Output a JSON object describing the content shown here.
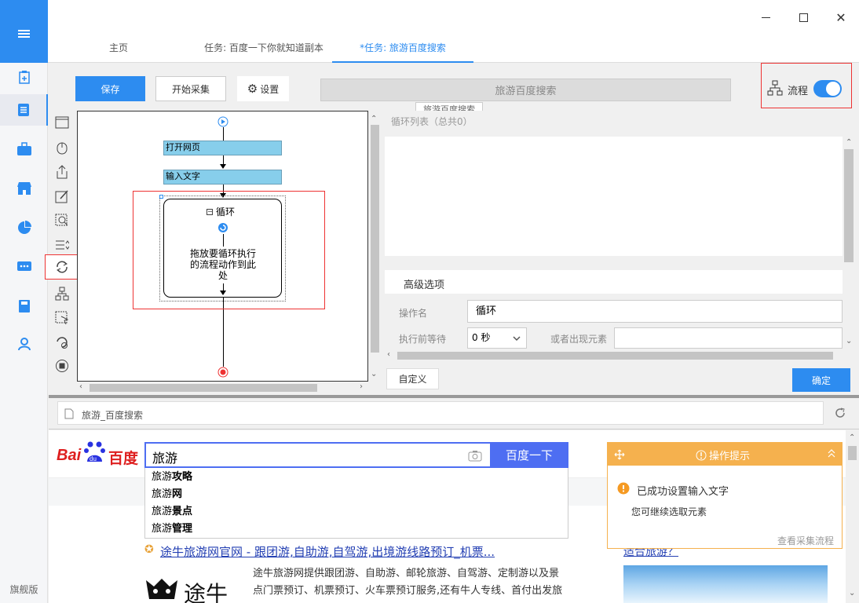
{
  "sidebar": {
    "edition": "旗舰版"
  },
  "tabs": [
    {
      "label": "主页"
    },
    {
      "label": "任务: 百度一下你就知道副本"
    },
    {
      "label": "*任务: 旅游百度搜索"
    }
  ],
  "toolbar": {
    "save": "保存",
    "start": "开始采集",
    "settings": "设置",
    "task_name": "旅游百度搜索",
    "tooltip": "旅游百度搜索",
    "flow_label": "流程"
  },
  "flow": {
    "node1": "打开网页",
    "node2": "输入文字",
    "loop_title": "循环",
    "drop_hint": "拖放要循环执行的流程动作到此处"
  },
  "panel": {
    "loop_list": "循环列表（总共0）",
    "advanced": "高级选项",
    "op_name_label": "操作名",
    "op_name_value": "循环",
    "wait_label": "执行前等待",
    "wait_value": "0 秒",
    "or_appear_label": "或者出现元素",
    "custom": "自定义",
    "confirm": "确定"
  },
  "browser": {
    "address": "旅游_百度搜索"
  },
  "baidu": {
    "query": "旅游",
    "search_button": "百度一下",
    "suggestions": [
      {
        "prefix": "旅游",
        "rest": "攻略"
      },
      {
        "prefix": "旅游",
        "rest": "网"
      },
      {
        "prefix": "旅游",
        "rest": "景点"
      },
      {
        "prefix": "旅游",
        "rest": "管理"
      }
    ]
  },
  "result": {
    "title": "途牛旅游网官网 - 跟团游,自助游,自驾游,出境游线路预订_机票...",
    "snippet_line1": "途牛旅游网提供跟团游、自助游、邮轮旅游、自驾游、定制游以及景",
    "snippet_line2": "点门票预订、机票预订、火车票预订服务,还有牛人专线、首付出发旅",
    "logo_text": "途牛",
    "side_link": "适合旅游？"
  },
  "hint": {
    "title": "操作提示",
    "message": "已成功设置输入文字",
    "sub": "您可继续选取元素",
    "link": "查看采集流程"
  },
  "colors": {
    "accent": "#2d8cf0",
    "highlight": "#e33",
    "warn": "#f5b14e"
  }
}
